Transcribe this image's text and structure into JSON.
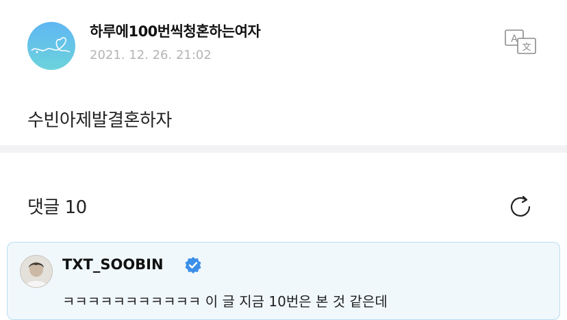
{
  "post": {
    "author": "하루에100번씩청혼하는여자",
    "date": "2021. 12. 26. 21:02",
    "body": "수빈아제발결혼하자"
  },
  "comments": {
    "header": "댓글 10",
    "items": [
      {
        "author": "TXT_SOOBIN",
        "verified": true,
        "text": "ㅋㅋㅋㅋㅋㅋㅋㅋㅋㅋㅋ 이 글 지금 10번은 본 것 같은데"
      }
    ]
  },
  "icons": {
    "translate": "translate-icon",
    "refresh": "refresh-icon",
    "verified": "verified-badge-icon"
  },
  "colors": {
    "avatar_gradient_top": "#5fb6f2",
    "avatar_gradient_bottom": "#6cd3dc",
    "comment_bg": "#f0f8fc",
    "comment_border": "#b8def0",
    "verified_blue": "#3b8fe8",
    "date_gray": "#b4b4b4"
  }
}
